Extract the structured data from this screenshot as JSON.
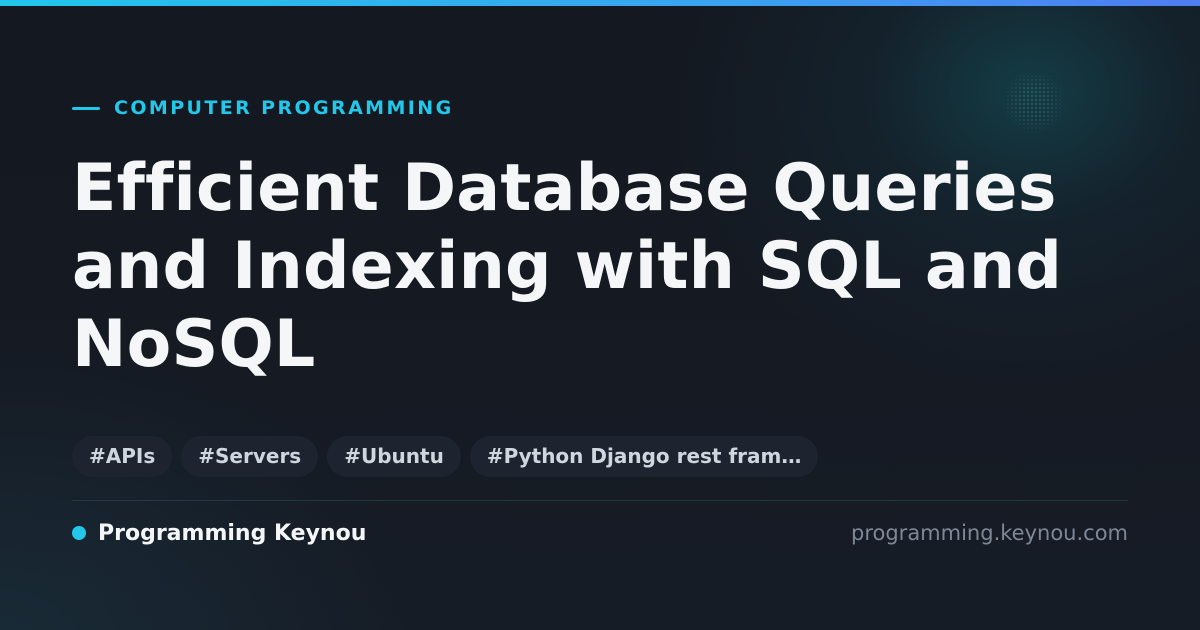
{
  "category": {
    "label": "COMPUTER PROGRAMMING"
  },
  "article": {
    "title": "Efficient Database Queries and Indexing with SQL and NoSQL"
  },
  "tags": [
    "#APIs",
    "#Servers",
    "#Ubuntu",
    "#Python Django rest fram…"
  ],
  "footer": {
    "brand": "Programming Keynou",
    "url": "programming.keynou.com"
  },
  "colors": {
    "accent": "#22c7ea",
    "background": "#141821",
    "title": "#f5f6f8",
    "tag_background": "#1d2430",
    "tag_text": "#d0d6de",
    "url_text": "#7f8896"
  }
}
